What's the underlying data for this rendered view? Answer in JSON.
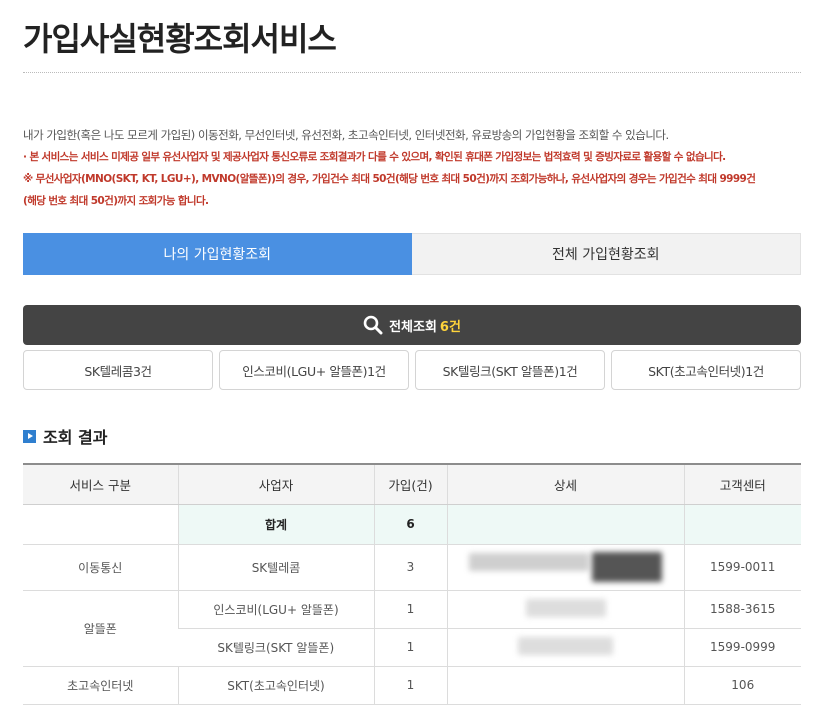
{
  "page": {
    "title": "가입사실현황조회서비스"
  },
  "intro": {
    "description": "내가 가입한(혹은 나도 모르게 가입된) 이동전화, 무선인터넷, 유선전화, 초고속인터넷, 인터넷전화, 유료방송의 가입현황을 조회할 수 있습니다.",
    "notice1": "· 본 서비스는 서비스 미제공 일부 유선사업자 및 제공사업자 통신오류로 조회결과가 다를 수 있으며, 확인된 휴대폰 가입정보는 법적효력 및 증빙자료로 활용할 수 없습니다.",
    "notice2a": "※ 무선사업자(MNO(SKT, KT, LGU+), MVNO(알뜰폰))의 경우, 가입건수 최대 50건(해당 번호 최대 50건)까지 조회가능하나, 유선사업자의 경우는 가입건수 최대 9999건",
    "notice2b": "(해당 번호 최대 50건)까지 조회가능 합니다."
  },
  "tabs": [
    {
      "label": "나의 가입현황조회",
      "active": true
    },
    {
      "label": "전체 가입현황조회",
      "active": false
    }
  ],
  "total": {
    "label": "전체조회",
    "count": "6건",
    "icon": "search-icon"
  },
  "chips": [
    {
      "label": "SK텔레콤3건"
    },
    {
      "label": "인스코비(LGU+ 알뜰폰)1건"
    },
    {
      "label": "SK텔링크(SKT 알뜰폰)1건"
    },
    {
      "label": "SKT(초고속인터넷)1건"
    }
  ],
  "results": {
    "heading": "조회 결과",
    "columns": [
      "서비스 구분",
      "사업자",
      "가입(건)",
      "상세",
      "고객센터"
    ],
    "sum_label": "합계",
    "sum_count": "6",
    "rows": {
      "mobile_category": "이동통신",
      "mvno_category": "알뜰폰",
      "broadband_category": "초고속인터넷",
      "r1_provider": "SK텔레콤",
      "r1_count": "3",
      "r1_center": "1599-0011",
      "r2_provider": "인스코비(LGU+ 알뜰폰)",
      "r2_count": "1",
      "r2_center": "1588-3615",
      "r3_provider": "SK텔링크(SKT 알뜰폰)",
      "r3_count": "1",
      "r3_center": "1599-0999",
      "r4_provider": "SKT(초고속인터넷)",
      "r4_count": "1",
      "r4_center": "106"
    }
  },
  "colors": {
    "tab_active": "#4a90e2",
    "total_bar": "#444444",
    "count_highlight": "#ffd43b",
    "notice_red": "#c0392b",
    "sum_row_bg": "#eef9f6"
  }
}
